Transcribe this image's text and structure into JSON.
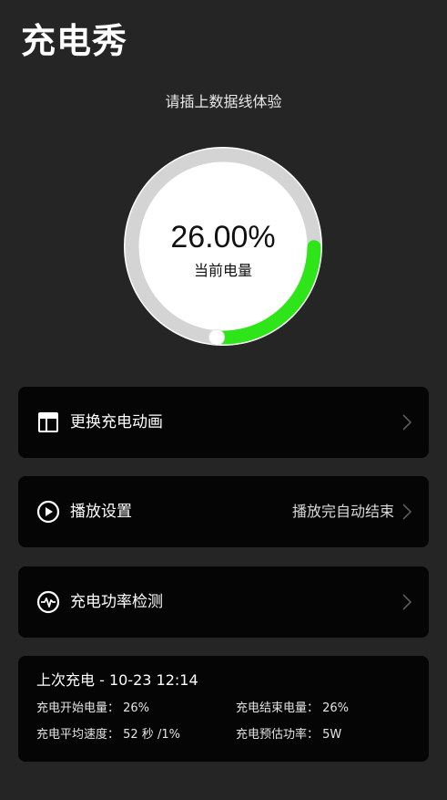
{
  "app": {
    "title": "充电秀"
  },
  "gauge": {
    "hint": "请插上数据线体验",
    "percent_text": "26.00%",
    "label": "当前电量",
    "level_fraction": 0.26,
    "track_color": "#d4d4d4",
    "fill_color": "#2ee51a"
  },
  "menu": [
    {
      "label": "更换充电动画",
      "icon": "layout-icon",
      "value": ""
    },
    {
      "label": "播放设置",
      "icon": "play-circle-icon",
      "value": "播放完自动结束"
    },
    {
      "label": "充电功率检测",
      "icon": "pulse-icon",
      "value": ""
    }
  ],
  "history": {
    "title": "上次充电  -  10-23 12:14",
    "start_level": "充电开始电量：  26%",
    "end_level": "充电结束电量：  26%",
    "avg_speed": "充电平均速度：  52 秒 /1%",
    "est_power": "充电预估功率：  5W"
  }
}
